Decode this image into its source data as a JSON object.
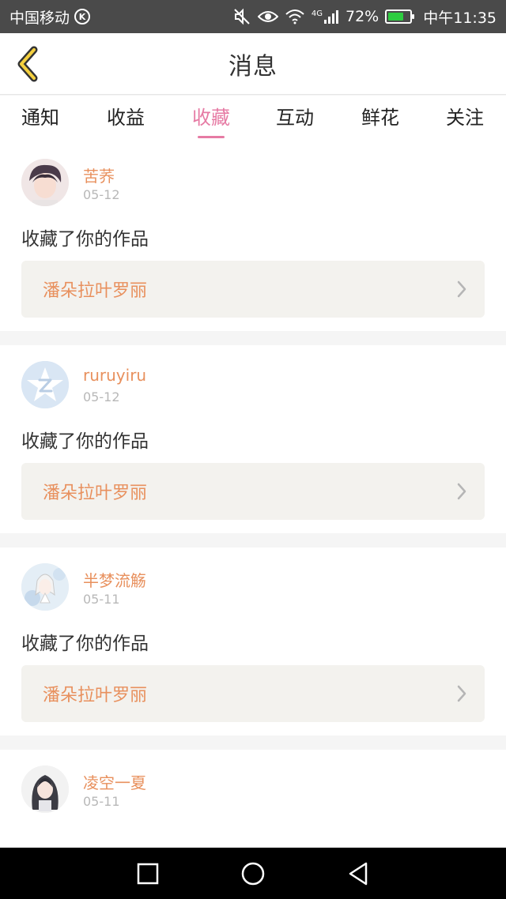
{
  "status_bar": {
    "carrier": "中国移动",
    "carrier_badge": "K",
    "network": "4G",
    "battery_percent": "72%",
    "battery_level": 0.72,
    "time": "中午11:35"
  },
  "header": {
    "title": "消息",
    "back_icon": "chevron-left-icon"
  },
  "tabs": [
    {
      "label": "通知",
      "active": false
    },
    {
      "label": "收益",
      "active": false
    },
    {
      "label": "收藏",
      "active": true
    },
    {
      "label": "互动",
      "active": false
    },
    {
      "label": "鲜花",
      "active": false
    },
    {
      "label": "关注",
      "active": false
    }
  ],
  "colors": {
    "accent_pink": "#e67ba4",
    "accent_orange": "#e8905d",
    "status_bar": "#4a4a4a"
  },
  "messages": [
    {
      "user": "苦荞",
      "date": "05-12",
      "action": "收藏了你的作品",
      "work": "潘朵拉叶罗丽"
    },
    {
      "user": "ruruyiru",
      "date": "05-12",
      "action": "收藏了你的作品",
      "work": "潘朵拉叶罗丽"
    },
    {
      "user": "半梦流觞",
      "date": "05-11",
      "action": "收藏了你的作品",
      "work": "潘朵拉叶罗丽"
    },
    {
      "user": "凌空一夏",
      "date": "05-11",
      "action": "",
      "work": ""
    }
  ],
  "nav_bar": {
    "recent_icon": "square-icon",
    "home_icon": "circle-icon",
    "back_icon": "triangle-back-icon"
  }
}
